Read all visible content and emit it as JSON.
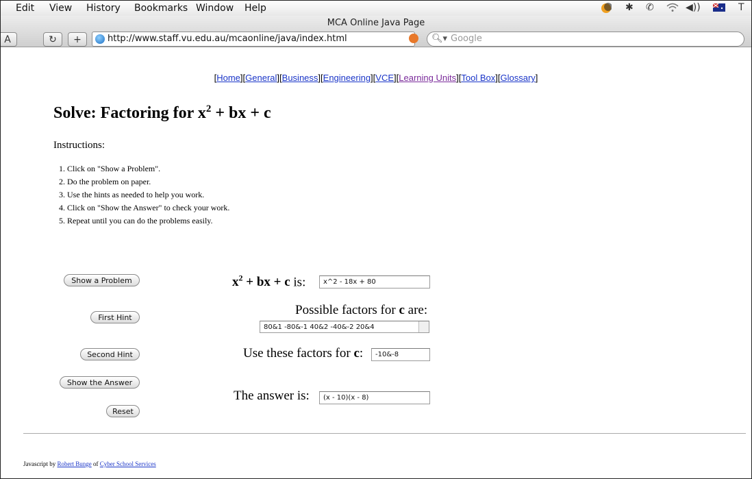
{
  "menubar": {
    "items": [
      "Edit",
      "View",
      "History",
      "Bookmarks",
      "Window",
      "Help"
    ],
    "tray_trailing_text": "T"
  },
  "window": {
    "title": "MCA Online Java Page",
    "toolbar": {
      "text_size_label": "A",
      "reload_label": "C",
      "add_label": "+"
    },
    "url": "http://www.staff.vu.edu.au/mcaonline/java/index.html",
    "search_placeholder": "Google"
  },
  "nav_links": [
    {
      "label": "Home",
      "visited": false
    },
    {
      "label": "General",
      "visited": false
    },
    {
      "label": "Business",
      "visited": false
    },
    {
      "label": "Engineering",
      "visited": false
    },
    {
      "label": "VCE",
      "visited": false
    },
    {
      "label": "Learning Units",
      "visited": true
    },
    {
      "label": "Tool Box",
      "visited": false
    },
    {
      "label": "Glossary",
      "visited": false
    }
  ],
  "page": {
    "heading_prefix": "Solve: Factoring for x",
    "heading_exp": "2",
    "heading_suffix": " + bx + c",
    "instructions_label": "Instructions:",
    "steps": [
      "Click on \"Show a Problem\".",
      "Do the problem on paper.",
      "Use the hints as needed to help you work.",
      "Click on \"Show the Answer\" to check your work.",
      "Repeat until you can do the problems easily."
    ]
  },
  "buttons": {
    "show_problem": "Show a Problem",
    "first_hint": "First Hint",
    "second_hint": "Second Hint",
    "show_answer": "Show the Answer",
    "reset": "Reset"
  },
  "form": {
    "expr_label_var": "x",
    "expr_label_exp": "2",
    "expr_label_rest": " + bx + c",
    "expr_label_is": " is:",
    "expr_value": "x^2 - 18x + 80",
    "factors_label_pre": "Possible factors for ",
    "factors_label_c": "c",
    "factors_label_post": " are:",
    "factors_value": "80&1 -80&-1 40&2 -40&-2 20&4",
    "use_label_pre": "Use these factors for ",
    "use_label_c": "c",
    "use_label_post": ":",
    "use_value": "-10&-8",
    "answer_label": "The answer is:",
    "answer_value": "(x - 10)(x - 8)"
  },
  "footer": {
    "prefix": "Javascript by ",
    "author": "Robert Bunge",
    "middle": " of ",
    "org": "Cyber School Services"
  }
}
